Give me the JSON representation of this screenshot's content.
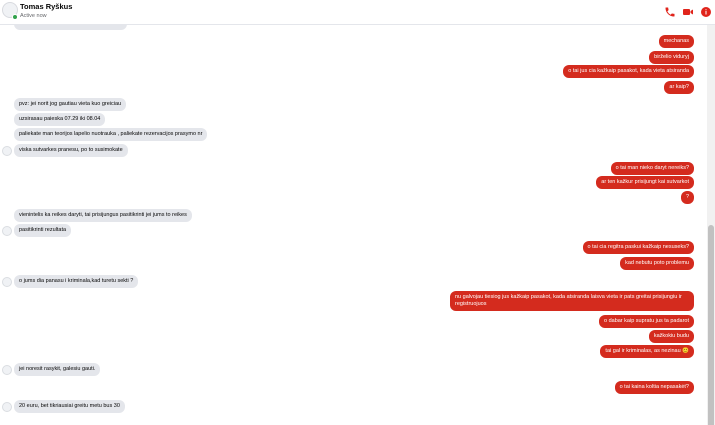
{
  "contact": {
    "name": "Tomas Ryškus",
    "status": "Active now"
  },
  "header_icons": [
    "phone-icon",
    "video-camera-icon",
    "info-icon"
  ],
  "colors": {
    "outgoing_bubble": "#d42b1e",
    "incoming_bubble": "#e4e6eb",
    "online": "#31a24c",
    "accent": "#e0241b"
  },
  "messages": [
    {
      "dir": "out",
      "text": "mechanas"
    },
    {
      "dir": "out",
      "text": "birželio viduryj"
    },
    {
      "dir": "out",
      "text": "o tai jus cia kažkaip pasakot, kada vieta atsiranda"
    },
    {
      "dir": "out",
      "text": "ar kaip?"
    },
    {
      "dir": "in",
      "text": "pvz: jei norit jog gautiau vieta kuo greiciau"
    },
    {
      "dir": "in",
      "text": "uzsirasau paieska 07.29 iki 08.04"
    },
    {
      "dir": "in",
      "text": "paliekate man teorijos lapelio nuotrauka , paliekate rezervacijos prasymo nr"
    },
    {
      "dir": "in",
      "text": "viska sutvarkes pranesu, po to susimokate"
    },
    {
      "dir": "out",
      "text": "o tai man nieko daryt nereiks?"
    },
    {
      "dir": "out",
      "text": "ar ten kažkur prisijungt kai sutvarkot"
    },
    {
      "dir": "out",
      "text": "?"
    },
    {
      "dir": "in",
      "text": "vienintelis ka reikes daryti, tai prisijungus pasitikrinti jei jums to reikes"
    },
    {
      "dir": "in",
      "text": "pasitikrinti rezultata"
    },
    {
      "dir": "out",
      "text": "o tai cia regitra paskui kažkaip nesuseks?"
    },
    {
      "dir": "out",
      "text": "kad nebutu poto problemu"
    },
    {
      "dir": "in",
      "text": "o jums dia panasu i kriminala,kad turetu sekti ?"
    },
    {
      "dir": "out",
      "text": "nu galvojau tiesiog jus kažkaip pasakot, kada atsiranda laisva vieta ir pats greitai prisijungiu ir registruojuos"
    },
    {
      "dir": "out",
      "text": "o dabar kaip supratu jus ta padarot"
    },
    {
      "dir": "out",
      "text": "kažkokiu budu"
    },
    {
      "dir": "out",
      "text": "tai gal ir kriminalas, as nezinau 😊"
    },
    {
      "dir": "in",
      "text": "jei noresit rasykit, galesiu gauti."
    },
    {
      "dir": "out",
      "text": "o tai kaina koltia nepasakėt?"
    },
    {
      "dir": "in",
      "text": "20 euru, bet tikriausiai greitu metu bus 30"
    }
  ]
}
